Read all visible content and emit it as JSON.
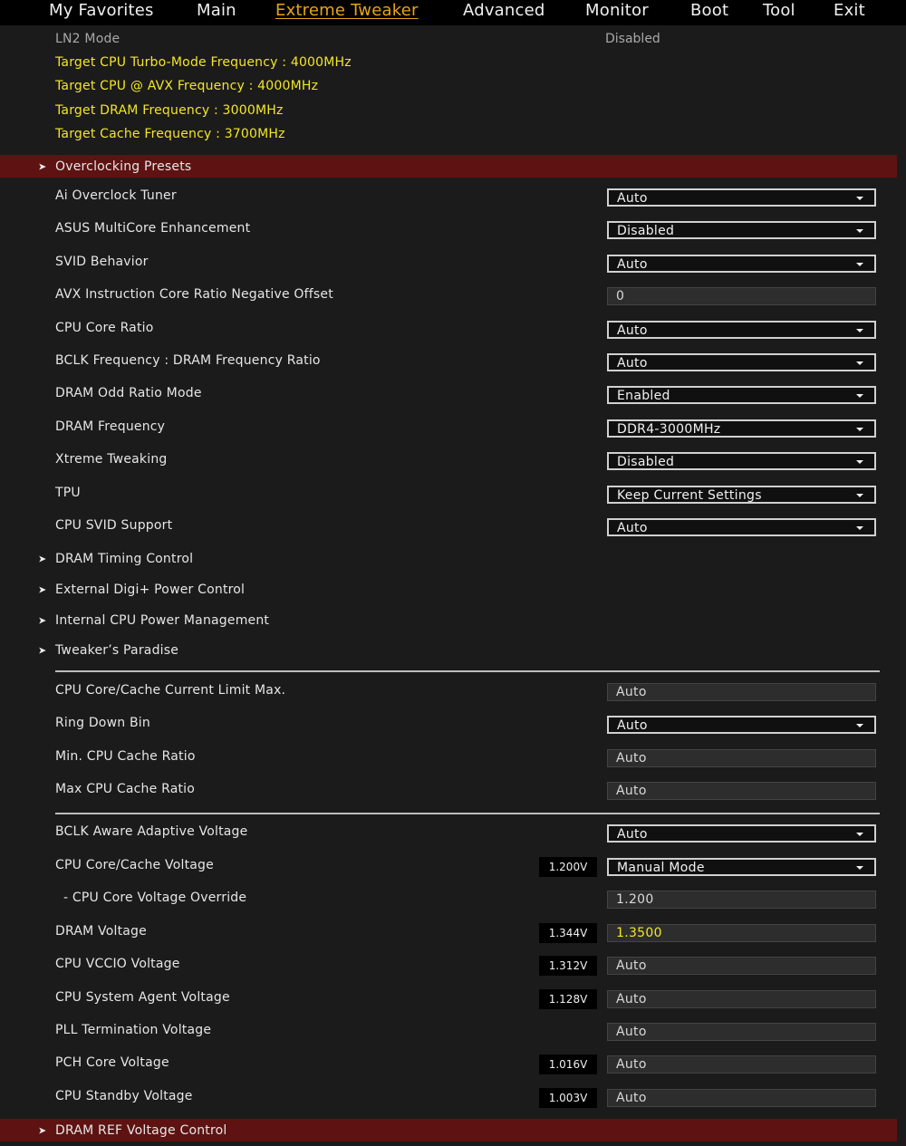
{
  "nav": {
    "tabs": [
      {
        "label": "My Favorites"
      },
      {
        "label": "Main"
      },
      {
        "label": "Extreme Tweaker",
        "active": true
      },
      {
        "label": "Advanced"
      },
      {
        "label": "Monitor"
      },
      {
        "label": "Boot"
      },
      {
        "label": "Tool"
      },
      {
        "label": "Exit"
      }
    ]
  },
  "ln2": {
    "label": "LN2 Mode",
    "value": "Disabled"
  },
  "targets": [
    "Target CPU Turbo-Mode Frequency : 4000MHz",
    "Target CPU @ AVX Frequency : 4000MHz",
    "Target DRAM Frequency : 3000MHz",
    "Target Cache Frequency : 3700MHz"
  ],
  "presets": {
    "label": "Overclocking Presets"
  },
  "settings": [
    {
      "label": "Ai Overclock Tuner",
      "value": "Auto"
    },
    {
      "label": "ASUS MultiCore Enhancement",
      "value": "Disabled"
    },
    {
      "label": "SVID Behavior",
      "value": "Auto"
    },
    {
      "label": "AVX Instruction Core Ratio Negative Offset",
      "value": "0"
    },
    {
      "label": "CPU Core Ratio",
      "value": "Auto"
    },
    {
      "label": "BCLK Frequency : DRAM Frequency Ratio",
      "value": "Auto"
    },
    {
      "label": "DRAM Odd Ratio Mode",
      "value": "Enabled"
    },
    {
      "label": "DRAM Frequency",
      "value": "DDR4-3000MHz"
    },
    {
      "label": "Xtreme Tweaking",
      "value": "Disabled"
    },
    {
      "label": "TPU",
      "value": "Keep Current Settings"
    },
    {
      "label": "CPU SVID Support",
      "value": "Auto"
    }
  ],
  "submenus": [
    {
      "label": "DRAM Timing Control"
    },
    {
      "label": "External Digi+ Power Control"
    },
    {
      "label": "Internal CPU Power Management"
    },
    {
      "label": "Tweaker’s Paradise"
    }
  ],
  "limits": [
    {
      "label": "CPU Core/Cache Current Limit Max.",
      "value": "Auto"
    },
    {
      "label": "Ring Down Bin",
      "value": "Auto"
    },
    {
      "label": "Min. CPU Cache Ratio",
      "value": "Auto"
    },
    {
      "label": "Max CPU Cache Ratio",
      "value": "Auto"
    }
  ],
  "voltages": [
    {
      "label": "BCLK Aware Adaptive Voltage",
      "value": "Auto"
    },
    {
      "label": "CPU Core/Cache Voltage",
      "reading": "1.200V",
      "value": "Manual Mode"
    },
    {
      "label": "- CPU Core Voltage Override",
      "value": "1.200"
    },
    {
      "label": "DRAM Voltage",
      "reading": "1.344V",
      "value": "1.3500"
    },
    {
      "label": "CPU VCCIO Voltage",
      "reading": "1.312V",
      "value": "Auto"
    },
    {
      "label": "CPU System Agent Voltage",
      "reading": "1.128V",
      "value": "Auto"
    },
    {
      "label": "PLL Termination Voltage",
      "value": "Auto"
    },
    {
      "label": "PCH Core Voltage",
      "reading": "1.016V",
      "value": "Auto"
    },
    {
      "label": "CPU Standby Voltage",
      "reading": "1.003V",
      "value": "Auto"
    }
  ],
  "dram_ref": {
    "label": "DRAM REF Voltage Control"
  },
  "colors": {
    "accent": "#e8a319",
    "highlight_band": "#5e1212",
    "yellow_text": "#f2e626",
    "background": "#1b1b1b"
  },
  "icons": {
    "submenu": "right-arrow-icon",
    "dropdown": "caret-down-icon"
  }
}
